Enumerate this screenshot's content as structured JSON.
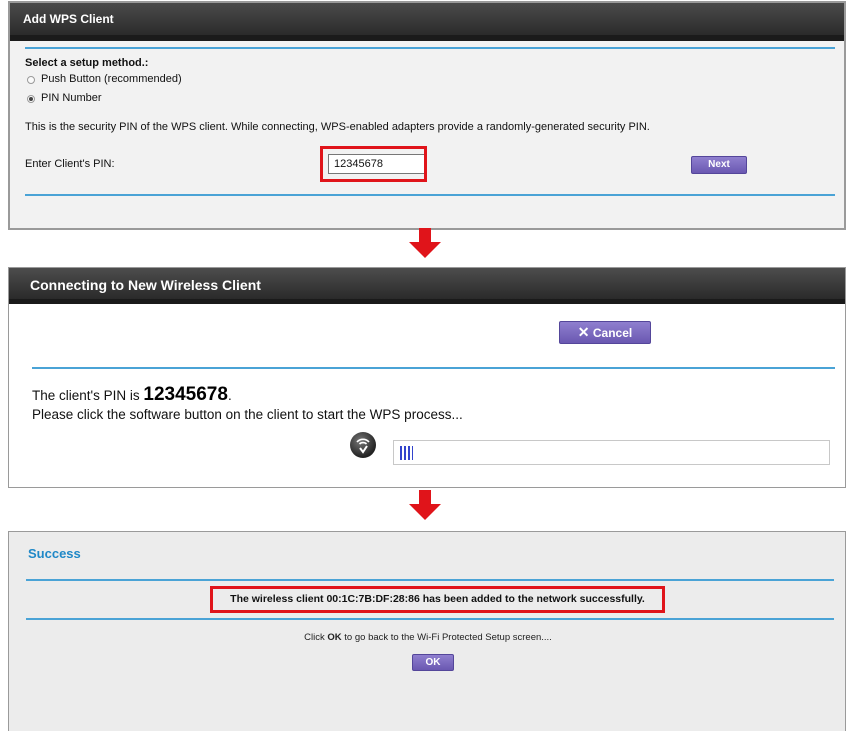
{
  "panel1": {
    "title": "Add WPS Client",
    "setup_heading": "Select a setup method.:",
    "options": [
      "Push Button (recommended)",
      "PIN Number"
    ],
    "selected_option": "PIN Number",
    "description": "This is the security PIN of the WPS client. While connecting, WPS-enabled adapters provide a randomly-generated security PIN.",
    "pin_label": "Enter Client's PIN:",
    "pin_value": "12345678",
    "next_button": "Next"
  },
  "panel2": {
    "title": "Connecting to New Wireless Client",
    "cancel_button": "Cancel",
    "pin_prefix": "The client's PIN is",
    "pin_value": "12345678",
    "pin_suffix": ".",
    "instruction": "Please click the software button on the client to start the WPS process...",
    "progress": 0.03,
    "icon": "wps-icon"
  },
  "panel3": {
    "title": "Success",
    "message": "The wireless client 00:1C:7B:DF:28:86 has been added to the network successfully.",
    "click_prefix": "Click",
    "click_ok_word": "OK",
    "click_suffix": "to go back to the Wi-Fi Protected Setup screen....",
    "ok_button": "OK"
  },
  "colors": {
    "highlight": "#e0141a",
    "accent_rule": "#4aa3d6",
    "button_purple": "#7a6ac2",
    "success_title": "#1f88c7"
  }
}
